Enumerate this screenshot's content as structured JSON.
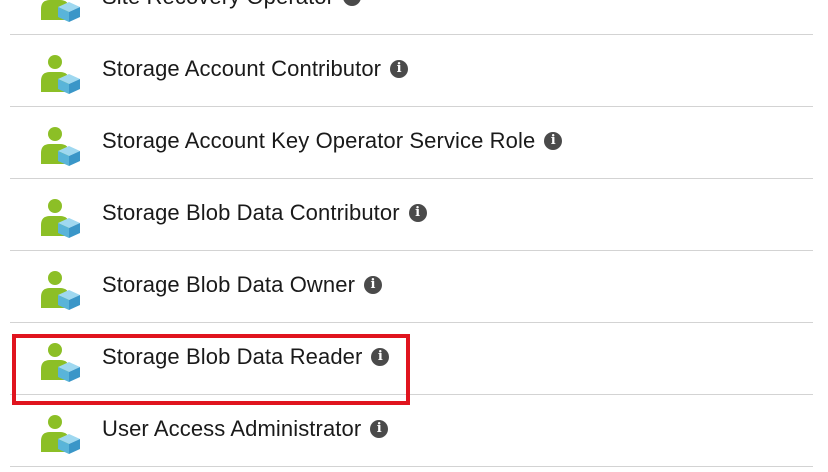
{
  "roles": [
    {
      "label": "Site Recovery Operator",
      "icon": "user-role-icon",
      "info_icon": "info-icon",
      "info_glyph": "i"
    },
    {
      "label": "Storage Account Contributor",
      "icon": "user-role-icon",
      "info_icon": "info-icon",
      "info_glyph": "i"
    },
    {
      "label": "Storage Account Key Operator Service Role",
      "icon": "user-role-icon",
      "info_icon": "info-icon",
      "info_glyph": "i"
    },
    {
      "label": "Storage Blob Data Contributor",
      "icon": "user-role-icon",
      "info_icon": "info-icon",
      "info_glyph": "i"
    },
    {
      "label": "Storage Blob Data Owner",
      "icon": "user-role-icon",
      "info_icon": "info-icon",
      "info_glyph": "i"
    },
    {
      "label": "Storage Blob Data Reader",
      "icon": "user-role-icon",
      "info_icon": "info-icon",
      "info_glyph": "i"
    },
    {
      "label": "User Access Administrator",
      "icon": "user-role-icon",
      "info_icon": "info-icon",
      "info_glyph": "i"
    }
  ],
  "highlight": {
    "label": "Storage Blob Data Reader",
    "color": "#e0141e"
  },
  "colors": {
    "person": "#8cbf26",
    "cube_light": "#9fd8f0",
    "cube_mid": "#59b4d9",
    "cube_dark": "#3a96c8",
    "divider": "#d3d3d3",
    "info": "#4a4a4a"
  }
}
